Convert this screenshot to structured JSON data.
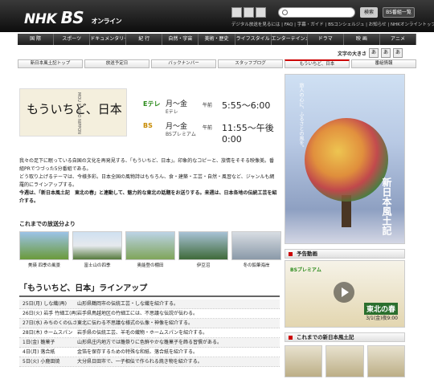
{
  "header": {
    "logo_nhk": "NHK",
    "logo_bs": "BS",
    "logo_sub": "オンライン",
    "search_button": "検索",
    "list_button": "BS番組一覧",
    "links": "デジタル放送を見るには | FAQ | 字幕・ガイド | BSコンシェルジュ | お知らせ | NHKオンライントップ"
  },
  "nav": [
    "国 際",
    "スポーツ",
    "ドキュメンタリー",
    "紀 行",
    "自然・宇宙",
    "美術・歴史",
    "ライフスタイル",
    "エンターテインメント",
    "ドラマ",
    "映 画",
    "アニメ"
  ],
  "text_size": {
    "label": "文字の大きさ",
    "small": "あ",
    "medium": "あ",
    "large": "あ"
  },
  "subnav": [
    "新日本風土記トップ",
    "放送予定日",
    "バックナンバー",
    "スタッフブログ",
    "もういちど、日本",
    "番組情報"
  ],
  "subnav_active": 4,
  "hero": {
    "title": "もういちど、日本",
    "roman": "MOU ICHIDO NIPPON"
  },
  "schedule": [
    {
      "channel": "Eテレ",
      "days": "月～金",
      "channel_name": "Eテレ",
      "time_label": "午前",
      "time": "5:55～6:00"
    },
    {
      "channel": "BS",
      "days": "月～金",
      "channel_name": "BSプレミアム",
      "time_label": "午前",
      "time": "11:55～午後0:00"
    }
  ],
  "description": {
    "p1": "我々の足下に眠っている自国の文化を再発見する、「もういちど、日本」。印象的なコピーと、旅情をそそる映像美。番組PRでつづった5分番組である。",
    "p2": "どう取り上げるテーマは、今様多彩。日本全国の風物詩はもちろん、食・建築・工芸・自然・風習など、ジャンルも網羅的にラインアップする。",
    "p3": "今週は、「新日本風土記　東北の春」と連動して、魅力的な東北の話題をお送りする。来週は、日本各地の伝統工芸を紹介する。"
  },
  "past_heading": "これまでの放送分より",
  "thumbnails": [
    "美瑛 四季の風景",
    "富士山の四季",
    "奥能登の棚田",
    "伊豆沼",
    "冬の鉛筆海岸"
  ],
  "lineup": {
    "title": "「もういちど、日本」ラインアップ",
    "rows": [
      {
        "date": "25日(月) しな織(再)",
        "text": "山形県鶴岡市の伝統工芸・しな織を紹介する。"
      },
      {
        "date": "26日(火) 岩手 竹細工(再)",
        "text": "岩手県鳥越地区の竹細工には、不思議な伝説が伝わる。"
      },
      {
        "date": "27日(水) みちのくの仏さま",
        "text": "東北に伝わる不思議な様式の仏像・神像を紹介する。"
      },
      {
        "date": "28日(木) ホームスパン",
        "text": "岩手県の伝統工芸、羊毛の織物・ホームスパンを紹介する。"
      },
      {
        "date": "1日(金) 雛菓子",
        "text": "山形県庄内地方では雛祭りに色鮮やかな雛菓子を飾る習慣がある。"
      },
      {
        "date": "4日(月) 落合紙",
        "text": "金箔を保存するための特殊な和紙、落合紙を紹介する。"
      },
      {
        "date": "5日(火) 小鹿田焼",
        "text": "大分県日田市で、一子相伝で作られる焼き物を紹介する。"
      }
    ]
  },
  "poster": {
    "tagline": "旅人の心に、ふるさとの風を。",
    "title": "新日本風土記"
  },
  "sidebar": {
    "video_heading": "予告動画",
    "video_title": "東北の春",
    "video_date": "3/1(金)夜9:00",
    "video_logo": "BSプレミアム",
    "past_heading": "これまでの新日本風土記"
  }
}
